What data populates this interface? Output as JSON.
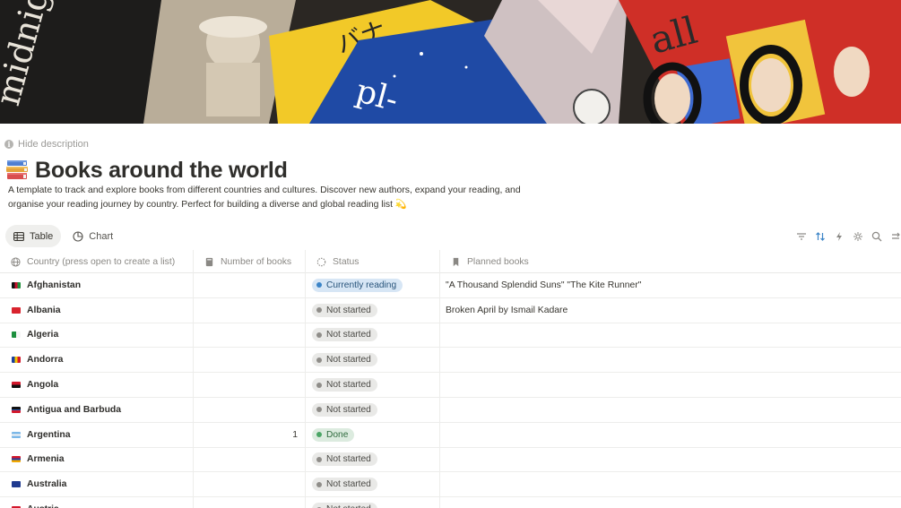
{
  "description_toggle": {
    "label": "Hide description"
  },
  "page": {
    "title": "Books around the world",
    "icon": "books-stack-icon",
    "description": "A template to track and explore books from different countries and cultures. Discover new authors, expand your reading, and organise your reading journey by country. Perfect for building a diverse and global reading list 💫"
  },
  "views": [
    {
      "label": "Table",
      "icon": "table-icon",
      "active": true
    },
    {
      "label": "Chart",
      "icon": "chart-pie-icon",
      "active": false
    }
  ],
  "toolbar": [
    "filter-icon",
    "sort-icon",
    "automation-bolt-icon",
    "customize-icon",
    "search-icon",
    "more-icon"
  ],
  "columns": [
    {
      "label": "Country (press open to create a list)",
      "icon": "globe-icon"
    },
    {
      "label": "Number of books",
      "icon": "book-icon"
    },
    {
      "label": "Status",
      "icon": "status-icon"
    },
    {
      "label": "Planned books",
      "icon": "bookmark-icon"
    }
  ],
  "status_colors": {
    "Currently reading": "#d7e6f5",
    "Not started": "#e9e9e7",
    "Done": "#dcebdf"
  },
  "rows": [
    {
      "country": "Afghanistan",
      "flag": "flag-afghanistan-icon",
      "books": "",
      "status": "Currently reading",
      "planned": "\"A Thousand Splendid Suns\" \"The Kite Runner\""
    },
    {
      "country": "Albania",
      "flag": "flag-albania-icon",
      "books": "",
      "status": "Not started",
      "planned": "Broken April by Ismail Kadare"
    },
    {
      "country": "Algeria",
      "flag": "flag-algeria-icon",
      "books": "",
      "status": "Not started",
      "planned": ""
    },
    {
      "country": "Andorra",
      "flag": "flag-andorra-icon",
      "books": "",
      "status": "Not started",
      "planned": ""
    },
    {
      "country": "Angola",
      "flag": "flag-angola-icon",
      "books": "",
      "status": "Not started",
      "planned": ""
    },
    {
      "country": "Antigua and Barbuda",
      "flag": "flag-antigua-icon",
      "books": "",
      "status": "Not started",
      "planned": ""
    },
    {
      "country": "Argentina",
      "flag": "flag-argentina-icon",
      "books": "1",
      "status": "Done",
      "planned": ""
    },
    {
      "country": "Armenia",
      "flag": "flag-armenia-icon",
      "books": "",
      "status": "Not started",
      "planned": ""
    },
    {
      "country": "Australia",
      "flag": "flag-australia-icon",
      "books": "",
      "status": "Not started",
      "planned": ""
    },
    {
      "country": "Austria",
      "flag": "flag-austria-icon",
      "books": "",
      "status": "Not started",
      "planned": ""
    }
  ]
}
